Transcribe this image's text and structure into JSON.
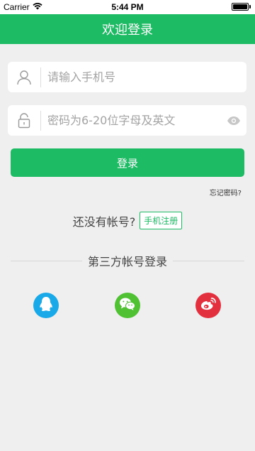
{
  "status_bar": {
    "carrier": "Carrier",
    "time": "5:44 PM",
    "battery_level": 1.0
  },
  "nav": {
    "title": "欢迎登录"
  },
  "form": {
    "phone_placeholder": "请输入手机号",
    "password_placeholder": "密码为6-20位字母及英文"
  },
  "buttons": {
    "login": "登录",
    "forgot_password": "忘记密码?",
    "register": "手机注册"
  },
  "register_prompt": "还没有帐号?",
  "third_party": {
    "title": "第三方帐号登录",
    "providers": [
      {
        "name": "qq",
        "icon": "qq-icon",
        "color": "#19a9e8"
      },
      {
        "name": "wechat",
        "icon": "wechat-icon",
        "color": "#4fc133"
      },
      {
        "name": "weibo",
        "icon": "weibo-icon",
        "color": "#e2303f"
      }
    ]
  },
  "colors": {
    "accent": "#1dbb63",
    "background": "#efefef"
  }
}
